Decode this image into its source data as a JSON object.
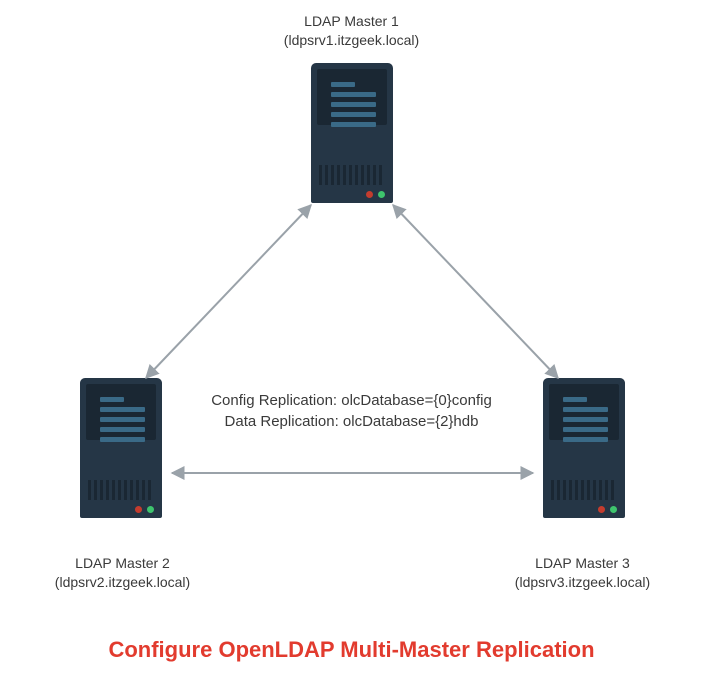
{
  "nodes": {
    "master1": {
      "title": "LDAP Master 1",
      "host": "(ldpsrv1.itzgeek.local)"
    },
    "master2": {
      "title": "LDAP Master 2",
      "host": "(ldpsrv2.itzgeek.local)"
    },
    "master3": {
      "title": "LDAP Master 3",
      "host": "(ldpsrv3.itzgeek.local)"
    }
  },
  "center": {
    "line1": "Config Replication: olcDatabase={0}config",
    "line2": "Data Replication: olcDatabase={2}hdb"
  },
  "caption": "Configure OpenLDAP Multi-Master Replication"
}
